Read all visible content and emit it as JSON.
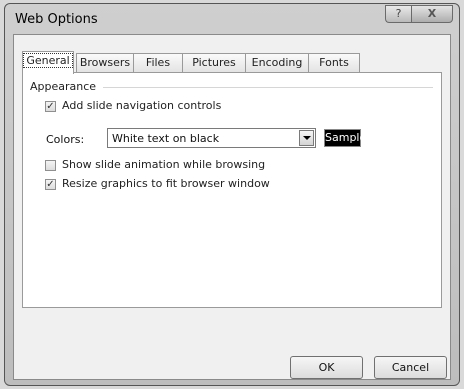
{
  "window": {
    "title": "Web Options"
  },
  "titlebar": {
    "help_glyph": "?",
    "close_glyph": "X"
  },
  "tabs": [
    {
      "label": "General",
      "active": true
    },
    {
      "label": "Browsers"
    },
    {
      "label": "Files"
    },
    {
      "label": "Pictures"
    },
    {
      "label": "Encoding"
    },
    {
      "label": "Fonts"
    }
  ],
  "appearance": {
    "group_label": "Appearance",
    "nav_controls": {
      "label": "Add slide navigation controls",
      "checked": true
    },
    "colors": {
      "label": "Colors:",
      "value": "White text on black",
      "sample": "Sample"
    },
    "animation": {
      "label": "Show slide animation while browsing",
      "checked": false
    },
    "resize": {
      "label": "Resize graphics to fit browser window",
      "checked": true
    }
  },
  "buttons": {
    "ok": "OK",
    "cancel": "Cancel"
  }
}
